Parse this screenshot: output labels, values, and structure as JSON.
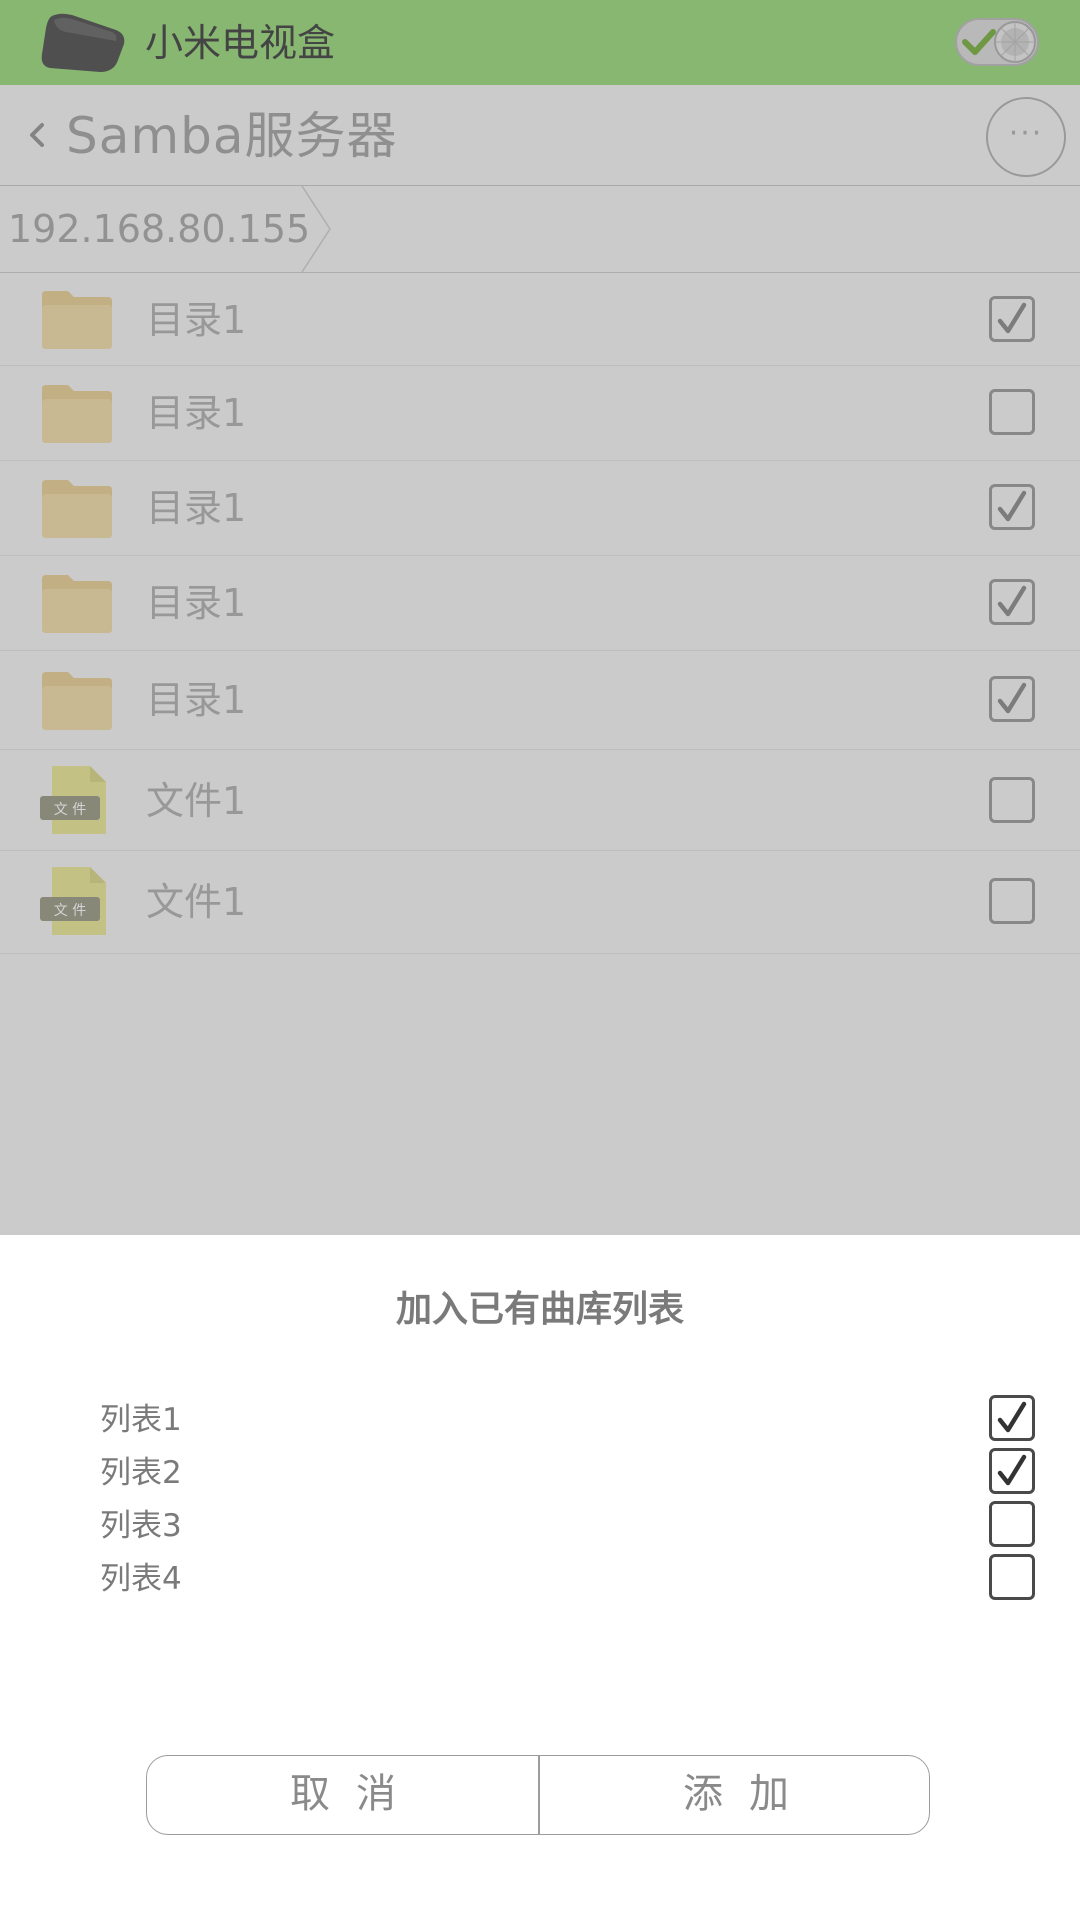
{
  "topbar": {
    "device_name": "小米电视盒",
    "device_icon": "tv-box-icon",
    "toggle_icon": "checkmark-toggle-icon",
    "bg_color": "#8fd66f"
  },
  "nav": {
    "back_icon": "chevron-left-icon",
    "title": "Samba服务器",
    "more_icon": "more-dots-icon",
    "more_label": "···"
  },
  "breadcrumb": {
    "path": "192.168.80.155"
  },
  "items": [
    {
      "type": "folder",
      "label": "目录1",
      "checked": true
    },
    {
      "type": "folder",
      "label": "目录1",
      "checked": false
    },
    {
      "type": "folder",
      "label": "目录1",
      "checked": true
    },
    {
      "type": "folder",
      "label": "目录1",
      "checked": true
    },
    {
      "type": "folder",
      "label": "目录1",
      "checked": true
    },
    {
      "type": "file",
      "label": "文件1",
      "badge": "文 件",
      "checked": false
    },
    {
      "type": "file",
      "label": "文件1",
      "badge": "文 件",
      "checked": false
    }
  ],
  "dialog": {
    "title": "加入已有曲库列表",
    "options": [
      {
        "label": "列表1",
        "checked": true
      },
      {
        "label": "列表2",
        "checked": true
      },
      {
        "label": "列表3",
        "checked": false
      },
      {
        "label": "列表4",
        "checked": false
      }
    ],
    "cancel_label": "取消",
    "add_label": "添加"
  }
}
